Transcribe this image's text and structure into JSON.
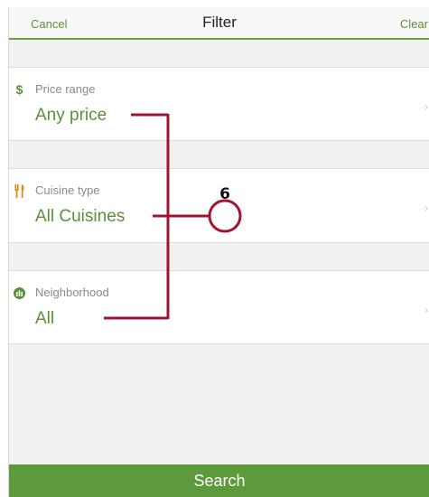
{
  "navbar": {
    "cancel_label": "Cancel",
    "title": "Filter",
    "clear_label": "Clear"
  },
  "filters": [
    {
      "label": "Price range",
      "value": "Any price",
      "icon": "dollar-icon",
      "icon_color": "#5c8f3a"
    },
    {
      "label": "Cuisine type",
      "value": "All Cuisines",
      "icon": "fork-knife-icon",
      "icon_color": "#e2860f"
    },
    {
      "label": "Neighborhood",
      "value": "All",
      "icon": "globe-icon",
      "icon_color": "#5c8f3a"
    }
  ],
  "search_button": {
    "label": "Search"
  },
  "callout": {
    "number": "6",
    "color": "#a0142e"
  },
  "colors": {
    "accent": "#5c8f3a",
    "search_bar": "#5c9a3c",
    "divider": "#6aa04a"
  }
}
